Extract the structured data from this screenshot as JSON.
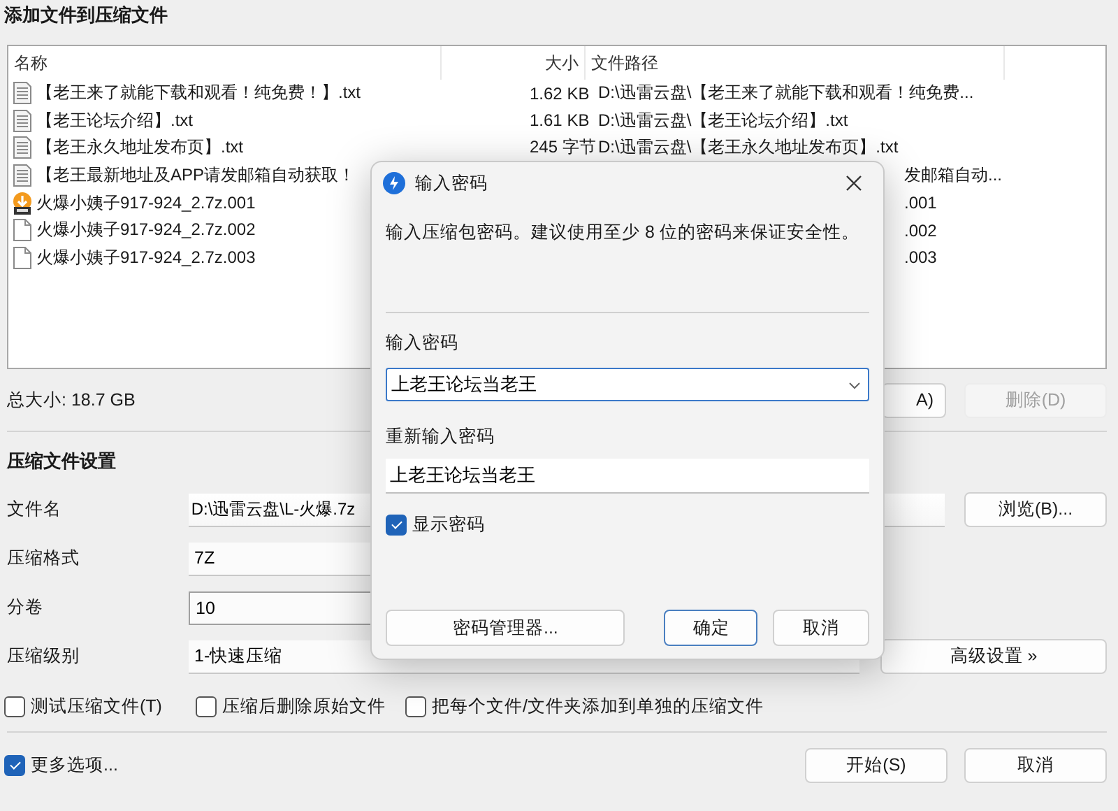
{
  "window": {
    "title": "添加文件到压缩文件"
  },
  "file_list": {
    "columns": [
      "名称",
      "大小",
      "文件路径"
    ],
    "rows": [
      {
        "kind": "text",
        "name": "【老王来了就能下载和观看！纯免费！】.txt",
        "size": "1.62 KB",
        "path": "D:\\迅雷云盘\\【老王来了就能下载和观看！纯免费...",
        "covered": false
      },
      {
        "kind": "text",
        "name": "【老王论坛介绍】.txt",
        "size": "1.61 KB",
        "path": "D:\\迅雷云盘\\【老王论坛介绍】.txt",
        "covered": false
      },
      {
        "kind": "text",
        "name": "【老王永久地址发布页】.txt",
        "size": "245 字节",
        "path": "D:\\迅雷云盘\\【老王永久地址发布页】.txt",
        "covered": false
      },
      {
        "kind": "text",
        "name": "【老王最新地址及APP请发邮箱自动获取！",
        "path": "发邮箱自动...",
        "covered": true
      },
      {
        "kind": "archive",
        "name": "火爆小姨子917-924_2.7z.001",
        "path": ".001",
        "covered": true
      },
      {
        "kind": "blank",
        "name": "火爆小姨子917-924_2.7z.002",
        "path": ".002",
        "covered": true
      },
      {
        "kind": "blank",
        "name": "火爆小姨子917-924_2.7z.003",
        "path": ".003",
        "covered": true
      }
    ]
  },
  "summary": "总大小: 18.7 GB",
  "list_buttons": [
    {
      "label": "A)",
      "disabled": false
    },
    {
      "label": "删除(D)",
      "disabled": true
    }
  ],
  "settings": {
    "heading": "压缩文件设置",
    "fields": [
      {
        "label": "文件名",
        "value": "D:\\迅雷云盘\\L-火爆.7z",
        "kind": "text"
      },
      {
        "label": "压缩格式",
        "value": "7Z",
        "kind": "select"
      },
      {
        "label": "分卷",
        "value": "10",
        "kind": "combo"
      },
      {
        "label": "压缩级别",
        "value": "1-快速压缩",
        "kind": "select"
      }
    ],
    "browse_button": "浏览(B)...",
    "advanced_button": "高级设置 »",
    "options": [
      {
        "label": "测试压缩文件(T)",
        "checked": false
      },
      {
        "label": "压缩后删除原始文件",
        "checked": false
      },
      {
        "label": "把每个文件/文件夹添加到单独的压缩文件",
        "checked": false
      }
    ]
  },
  "footer": {
    "more_options": {
      "label": "更多选项...",
      "checked": true
    },
    "buttons": [
      "开始(S)",
      "取消"
    ]
  },
  "dialog": {
    "title": "输入密码",
    "message": "输入压缩包密码。建议使用至少 8 位的密码来保证安全性。",
    "password": {
      "label": "输入密码",
      "value": "上老王论坛当老王"
    },
    "confirm": {
      "label": "重新输入密码",
      "value": "上老王论坛当老王"
    },
    "show_password": {
      "label": "显示密码",
      "checked": true
    },
    "buttons": [
      {
        "label": "密码管理器...",
        "default": false
      },
      {
        "label": "确定",
        "default": true
      },
      {
        "label": "取消",
        "default": false
      }
    ]
  }
}
